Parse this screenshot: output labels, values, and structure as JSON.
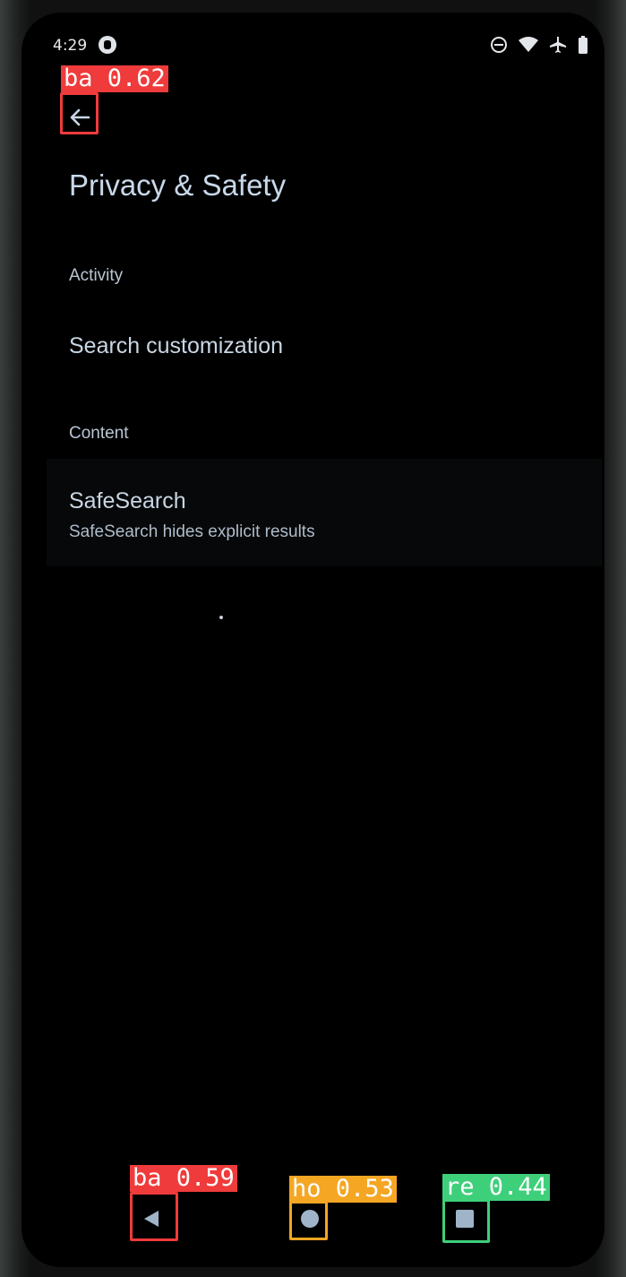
{
  "status_bar": {
    "time": "4:29",
    "icons": [
      "app-notification-icon",
      "do-not-disturb-icon",
      "wifi-icon",
      "airplane-mode-icon",
      "battery-icon"
    ]
  },
  "header": {
    "back_icon": "arrow-back-icon",
    "title": "Privacy & Safety"
  },
  "sections": [
    {
      "header": "Activity",
      "items": [
        {
          "title": "Search customization"
        }
      ]
    },
    {
      "header": "Content",
      "items": [
        {
          "title": "SafeSearch",
          "subtitle": "SafeSearch hides explicit results"
        }
      ]
    }
  ],
  "navigation_bar": {
    "back_icon": "triangle-back-icon",
    "home_icon": "circle-home-icon",
    "recents_icon": "square-recents-icon"
  },
  "detections": [
    {
      "label": "ba 0.62",
      "color": "#ef3b3b"
    },
    {
      "label": "ba 0.59",
      "color": "#ef3b3b"
    },
    {
      "label": "ho 0.53",
      "color": "#f5a623"
    },
    {
      "label": "re 0.44",
      "color": "#3ecf7a"
    }
  ]
}
